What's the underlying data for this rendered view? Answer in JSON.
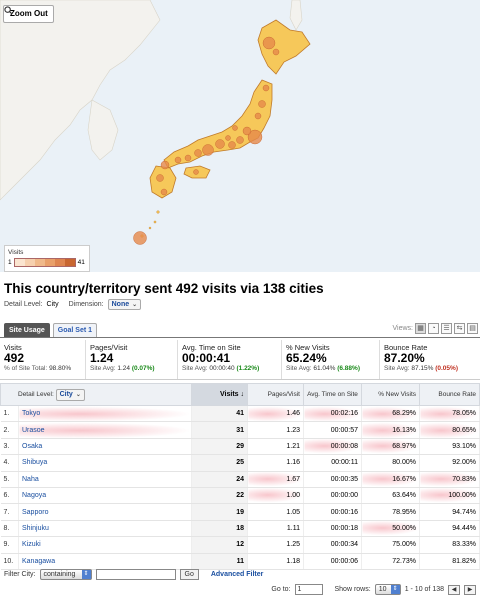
{
  "map": {
    "zoom_label": "Zoom Out",
    "legend_title": "Visits",
    "legend_min": "1",
    "legend_max": "41",
    "colors": {
      "sea": "#eaf1f7",
      "land_other": "#f2f2f0",
      "japan": "#f6c85a",
      "japan_stroke": "#c07a2a",
      "bubble": "#e6894a"
    }
  },
  "header": {
    "headline": "This country/territory sent 492 visits via 138 cities",
    "detail_label": "Detail Level:",
    "detail_value": "City",
    "dimension_label": "Dimension:",
    "dimension_value": "None"
  },
  "tabs": [
    {
      "label": "Site Usage",
      "active": true
    },
    {
      "label": "Goal Set 1",
      "active": false
    }
  ],
  "views_label": "Views:",
  "summary": [
    {
      "title": "Visits",
      "value": "492",
      "sub_label": "% of Site Total:",
      "sub_value": "98.80%",
      "delta": ""
    },
    {
      "title": "Pages/Visit",
      "value": "1.24",
      "sub_label": "Site Avg:",
      "sub_value": "1.24",
      "delta": "(0.07%)"
    },
    {
      "title": "Avg. Time on Site",
      "value": "00:00:41",
      "sub_label": "Site Avg:",
      "sub_value": "00:00:40",
      "delta": "(1.22%)"
    },
    {
      "title": "% New Visits",
      "value": "65.24%",
      "sub_label": "Site Avg:",
      "sub_value": "61.04%",
      "delta": "(6.88%)"
    },
    {
      "title": "Bounce Rate",
      "value": "87.20%",
      "sub_label": "Site Avg:",
      "sub_value": "87.15%",
      "delta": "(0.05%)"
    }
  ],
  "table": {
    "dim_label": "Detail Level:",
    "dim_value": "City",
    "columns": [
      "Visits ↓",
      "Pages/Visit",
      "Avg. Time on Site",
      "% New Visits",
      "Bounce Rate"
    ],
    "rows": [
      {
        "n": "1.",
        "city": "Tokyo",
        "visits": "41",
        "ppv": "1.46",
        "time": "00:02:16",
        "nv": "68.29%",
        "br": "78.05%"
      },
      {
        "n": "2.",
        "city": "Urasoe",
        "visits": "31",
        "ppv": "1.23",
        "time": "00:00:57",
        "nv": "16.13%",
        "br": "80.65%"
      },
      {
        "n": "3.",
        "city": "Osaka",
        "visits": "29",
        "ppv": "1.21",
        "time": "00:00:08",
        "nv": "68.97%",
        "br": "93.10%"
      },
      {
        "n": "4.",
        "city": "Shibuya",
        "visits": "25",
        "ppv": "1.16",
        "time": "00:00:11",
        "nv": "80.00%",
        "br": "92.00%"
      },
      {
        "n": "5.",
        "city": "Naha",
        "visits": "24",
        "ppv": "1.67",
        "time": "00:00:35",
        "nv": "16.67%",
        "br": "70.83%"
      },
      {
        "n": "6.",
        "city": "Nagoya",
        "visits": "22",
        "ppv": "1.00",
        "time": "00:00:00",
        "nv": "63.64%",
        "br": "100.00%"
      },
      {
        "n": "7.",
        "city": "Sapporo",
        "visits": "19",
        "ppv": "1.05",
        "time": "00:00:16",
        "nv": "78.95%",
        "br": "94.74%"
      },
      {
        "n": "8.",
        "city": "Shinjuku",
        "visits": "18",
        "ppv": "1.11",
        "time": "00:00:18",
        "nv": "50.00%",
        "br": "94.44%"
      },
      {
        "n": "9.",
        "city": "Kizuki",
        "visits": "12",
        "ppv": "1.25",
        "time": "00:00:34",
        "nv": "75.00%",
        "br": "83.33%"
      },
      {
        "n": "10.",
        "city": "Kanagawa",
        "visits": "11",
        "ppv": "1.18",
        "time": "00:00:06",
        "nv": "72.73%",
        "br": "81.82%"
      }
    ]
  },
  "filter": {
    "label": "Filter City:",
    "mode": "containing",
    "input_value": "",
    "go": "Go",
    "advanced": "Advanced Filter"
  },
  "pager": {
    "goto_label": "Go to:",
    "goto_value": "1",
    "show_rows_label": "Show rows:",
    "show_rows_value": "10",
    "range": "1 - 10 of 138",
    "prev": "◀",
    "next": "▶"
  }
}
